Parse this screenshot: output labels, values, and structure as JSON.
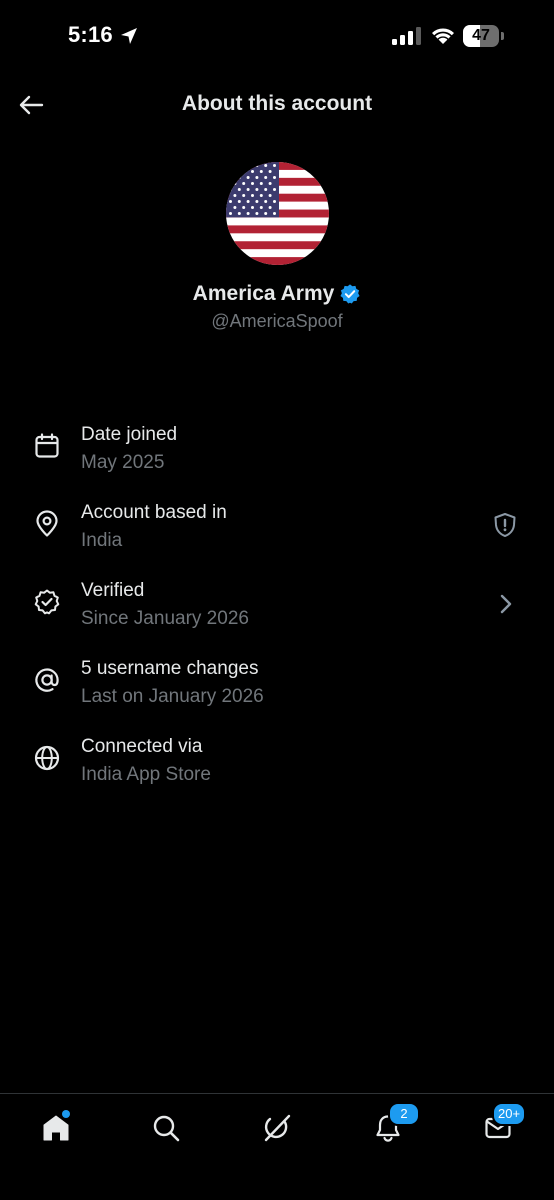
{
  "status_bar": {
    "time": "5:16",
    "battery_level": "47",
    "battery_fraction": 0.47,
    "icons": [
      "location-arrow-icon",
      "cellular-signal-icon",
      "wifi-icon",
      "battery-icon"
    ]
  },
  "header": {
    "title": "About this account",
    "back_icon": "back-arrow-icon"
  },
  "profile": {
    "display_name": "America Army",
    "handle": "@AmericaSpoof",
    "verified": true,
    "avatar": "us-flag-avatar"
  },
  "info_items": [
    {
      "icon": "calendar-icon",
      "label": "Date joined",
      "value": "May 2025"
    },
    {
      "icon": "location-pin-icon",
      "label": "Account based in",
      "value": "India",
      "trailing_icon": "shield-alert-icon"
    },
    {
      "icon": "verified-check-icon",
      "label": "Verified",
      "value": "Since January 2026",
      "trailing_icon": "chevron-right-icon"
    },
    {
      "icon": "at-sign-icon",
      "label": "5 username changes",
      "value": "Last on January 2026"
    },
    {
      "icon": "globe-icon",
      "label": "Connected via",
      "value": "India App Store"
    }
  ],
  "bottom_nav": {
    "items": [
      {
        "icon": "home-icon",
        "has_dot": true
      },
      {
        "icon": "search-icon"
      },
      {
        "icon": "grok-icon"
      },
      {
        "icon": "notifications-bell-icon",
        "badge": "2"
      },
      {
        "icon": "messages-envelope-icon",
        "badge": "20+"
      }
    ]
  },
  "colors": {
    "background": "#000000",
    "primary_text": "#e7e9ea",
    "secondary_text": "#71767b",
    "accent": "#1d9bf0",
    "divider": "#2f3336"
  }
}
